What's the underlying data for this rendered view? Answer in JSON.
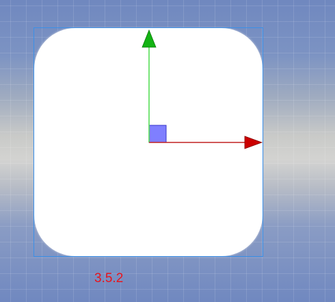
{
  "scene": {
    "label_text": "3.5.2",
    "colors": {
      "background_top": "#7088bf",
      "background_middle": "#d3d3d1",
      "shape_fill": "#ffffff",
      "selection_outline": "#3a90e8",
      "x_axis": "#cc0000",
      "y_axis": "#00bb00",
      "xy_plane_handle": "#7f7fff",
      "label": "#e8141c"
    }
  },
  "gizmo": {
    "type": "move",
    "axes": [
      "x",
      "y"
    ],
    "icons": [
      "x-axis-arrow-icon",
      "y-axis-arrow-icon",
      "xy-plane-handle-icon"
    ]
  }
}
